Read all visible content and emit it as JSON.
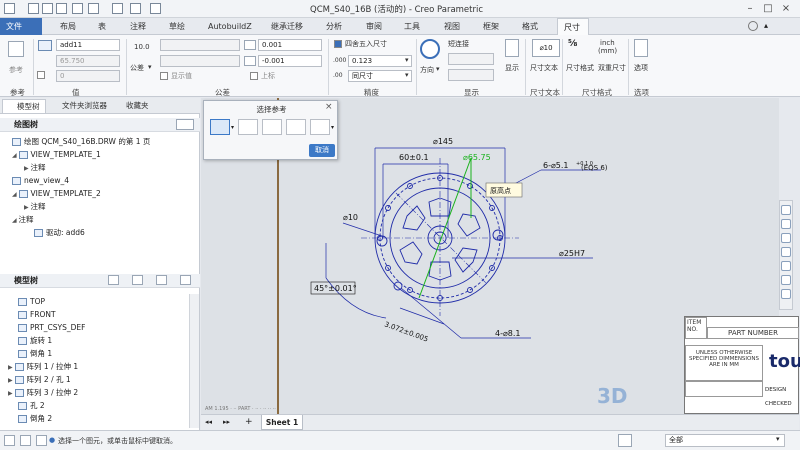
{
  "window": {
    "title": "QCM_S40_16B (活动的) - Creo Parametric"
  },
  "tabs": [
    {
      "label": "文件"
    },
    {
      "label": "布局"
    },
    {
      "label": "表"
    },
    {
      "label": "注释"
    },
    {
      "label": "草绘"
    },
    {
      "label": "AutobuildZ"
    },
    {
      "label": "继承迁移"
    },
    {
      "label": "分析"
    },
    {
      "label": "审阅"
    },
    {
      "label": "工具"
    },
    {
      "label": "视图"
    },
    {
      "label": "框架"
    },
    {
      "label": "格式"
    },
    {
      "label": "尺寸"
    }
  ],
  "ribbon": {
    "ref_label": "参考",
    "name_value": "add11",
    "val_a": "10.0",
    "val_b": "65.750",
    "val_c": "0",
    "tolerance_label": "公差",
    "tol_upper": "0.001",
    "tol_lower": "-0.001",
    "show_value_label": "显示值",
    "upper_label": "上标",
    "round_checkbox_label": "四舍五入尺寸",
    "precision_value": "0.123",
    "same_size_label": "同尺寸",
    "direction_label": "方向",
    "leader_label": "短连接",
    "display_label": "显示",
    "dim_text_label": "尺寸文本",
    "dim_format_label": "尺寸格式",
    "dual_dim_label": "双重尺寸",
    "options_label": "选项",
    "dim_preview": "⌀10",
    "unit_inch": "inch",
    "unit_mm": "(mm)",
    "groups": [
      "参考",
      "值",
      "公差",
      "精度",
      "显示",
      "尺寸文本",
      "尺寸格式",
      "选项"
    ]
  },
  "left_panel": {
    "tabs": [
      "模型树",
      "文件夹浏览器",
      "收藏夹"
    ],
    "detail_tree_header": "绘图树",
    "detail_tree_items": [
      "绘图 QCM_S40_16B.DRW 的第 1 页",
      "VIEW_TEMPLATE_1",
      "注释",
      "new_view_4",
      "VIEW_TEMPLATE_2",
      "注释",
      "注释",
      "驱动: add6"
    ],
    "model_tree_header": "模型树",
    "model_tree_items": [
      "TOP",
      "FRONT",
      "PRT_CSYS_DEF",
      "旋转 1",
      "倒角 1",
      "阵列 1 / 拉伸 1",
      "阵列 2 / 孔 1",
      "阵列 3 / 拉伸 2",
      "孔 2",
      "倒角 2"
    ]
  },
  "dialog": {
    "title": "选择参考",
    "cancel_label": "取消"
  },
  "drawing": {
    "dim_145": "⌀145",
    "dim_60": "60±0.1",
    "dim_6575": "⌀65.75",
    "dim_holes": "6-⌀5.1",
    "dim_holes_tol": "+0.1 0",
    "dim_eqs": "(EQS 6)",
    "tooltip": "原高点",
    "dim_10": "⌀10",
    "dim_25": "⌀25H7",
    "dim_angle": "45°±0.01°",
    "dim_3072": "3.072±0.005",
    "dim_481": "4-⌀8.1",
    "titleblock": {
      "item": "ITEM NO.",
      "part_number": "PART NUMBER",
      "notes": [
        "UNLESS OTHERWISE",
        "SPECIFIED DIMMENSIONS",
        "ARE IN MM"
      ],
      "logo": "tou",
      "design": "DESIGN",
      "checked": "CHECKED"
    }
  },
  "sheet_tab": "Sheet 1",
  "status": {
    "message": "选择一个图元，或单击鼠标中键取消。",
    "filter": "全部"
  },
  "watermark": "3D"
}
